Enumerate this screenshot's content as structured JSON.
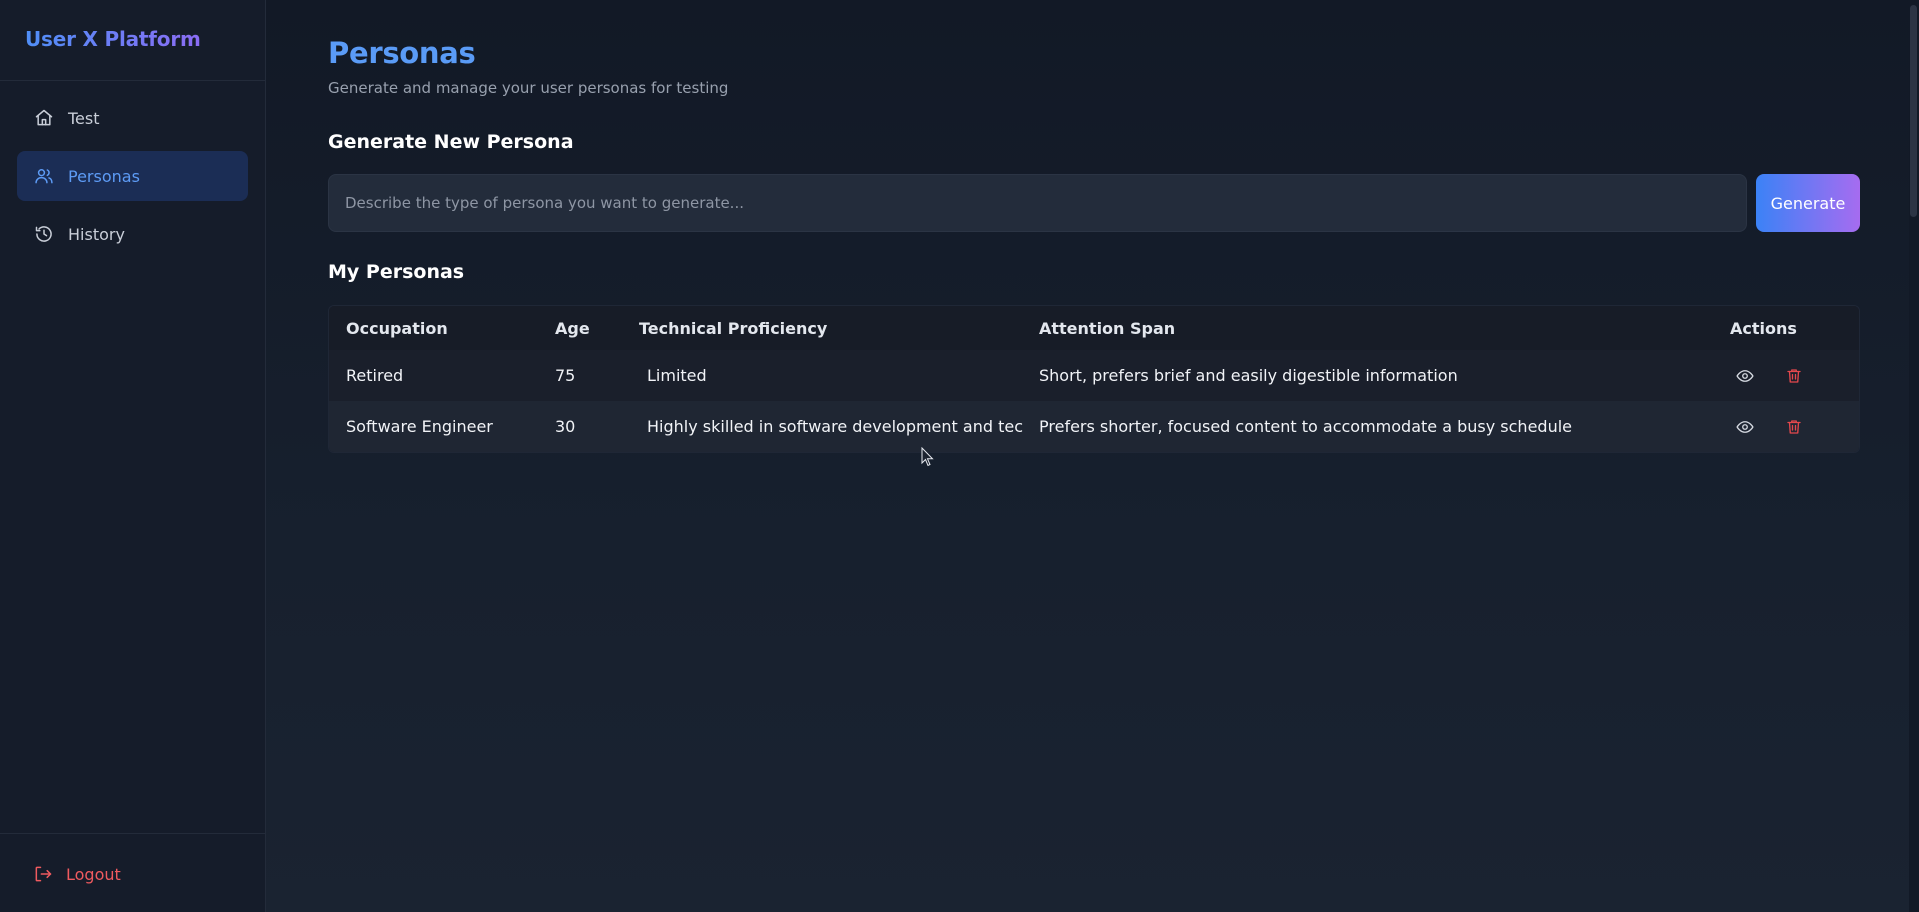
{
  "app": {
    "brand": "User X Platform"
  },
  "sidebar": {
    "items": [
      {
        "label": "Test",
        "icon": "home-icon",
        "active": false
      },
      {
        "label": "Personas",
        "icon": "users-icon",
        "active": true
      },
      {
        "label": "History",
        "icon": "history-icon",
        "active": false
      }
    ],
    "logout_label": "Logout"
  },
  "page": {
    "title": "Personas",
    "subtitle": "Generate and manage your user personas for testing"
  },
  "generate": {
    "title": "Generate New Persona",
    "placeholder": "Describe the type of persona you want to generate...",
    "value": "",
    "button_label": "Generate"
  },
  "personas": {
    "title": "My Personas",
    "columns": {
      "occupation": "Occupation",
      "age": "Age",
      "tech": "Technical Proficiency",
      "attention": "Attention Span",
      "actions": "Actions"
    },
    "rows": [
      {
        "occupation": "Retired",
        "age": "75",
        "tech": "Limited",
        "attention": "Short, prefers brief and easily digestible information"
      },
      {
        "occupation": "Software Engineer",
        "age": "30",
        "tech": "Highly skilled in software development and tec",
        "attention": "Prefers shorter, focused content to accommodate a busy schedule"
      }
    ]
  },
  "colors": {
    "accent": "#5a9bf6",
    "active_nav_bg": "#1b2d55",
    "danger": "#ef5a5f",
    "button_gradient_start": "#3b82f6",
    "button_gradient_end": "#a66cf0"
  }
}
